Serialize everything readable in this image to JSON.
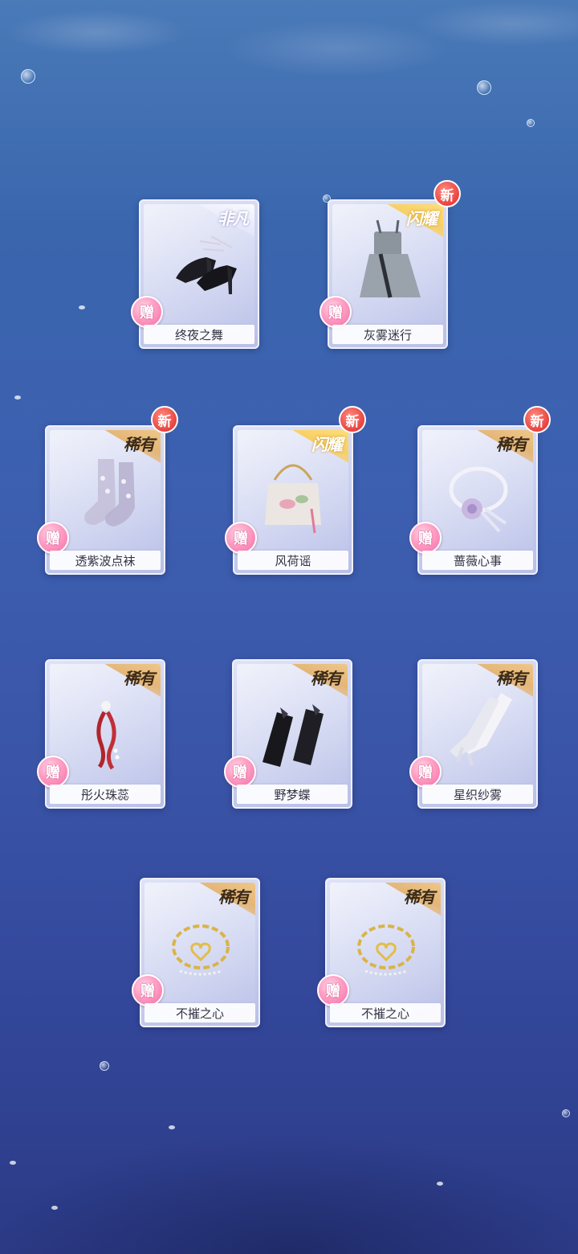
{
  "cards": [
    {
      "name": "终夜之舞",
      "rarity": "非凡",
      "rarity_style": "plain",
      "is_new": false,
      "gift": "赠",
      "icon": "black-high-heels-icon"
    },
    {
      "name": "灰雾迷行",
      "rarity": "闪耀",
      "rarity_style": "shine",
      "is_new": true,
      "new_label": "新",
      "gift": "赠",
      "icon": "grey-overall-dress-icon"
    },
    {
      "name": "透紫波点袜",
      "rarity": "稀有",
      "rarity_style": "gold",
      "is_new": true,
      "new_label": "新",
      "gift": "赠",
      "icon": "polka-dot-socks-icon"
    },
    {
      "name": "风荷谣",
      "rarity": "闪耀",
      "rarity_style": "shine",
      "is_new": true,
      "new_label": "新",
      "gift": "赠",
      "icon": "lotus-handbag-icon"
    },
    {
      "name": "蔷薇心事",
      "rarity": "稀有",
      "rarity_style": "gold",
      "is_new": true,
      "new_label": "新",
      "gift": "赠",
      "icon": "rose-choker-icon"
    },
    {
      "name": "彤火珠蕊",
      "rarity": "稀有",
      "rarity_style": "gold",
      "is_new": false,
      "gift": "赠",
      "icon": "red-tassel-earring-icon"
    },
    {
      "name": "野梦蝶",
      "rarity": "稀有",
      "rarity_style": "gold",
      "is_new": false,
      "gift": "赠",
      "icon": "black-arm-sleeves-icon"
    },
    {
      "name": "星织纱雾",
      "rarity": "稀有",
      "rarity_style": "gold",
      "is_new": false,
      "gift": "赠",
      "icon": "white-gloves-icon"
    },
    {
      "name": "不摧之心",
      "rarity": "稀有",
      "rarity_style": "gold",
      "is_new": false,
      "gift": "赠",
      "icon": "gold-heart-chain-icon"
    },
    {
      "name": "不摧之心",
      "rarity": "稀有",
      "rarity_style": "gold",
      "is_new": false,
      "gift": "赠",
      "icon": "gold-heart-chain-icon"
    }
  ]
}
